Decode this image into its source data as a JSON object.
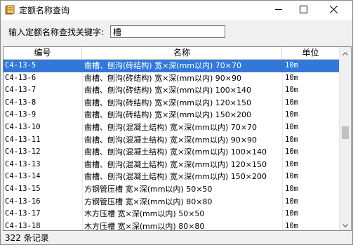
{
  "window": {
    "title": "定额名称查询",
    "app_icon": "book-icon"
  },
  "search": {
    "label": "输入定额名称查找关键字:",
    "value": "槽"
  },
  "table": {
    "columns": [
      "编号",
      "名称",
      "单位"
    ],
    "rows": [
      {
        "code": "C4-13-5",
        "name": "凿槽、刨沟(砖结构) 宽×深(mm以内) 70×70",
        "unit": "10m",
        "selected": true
      },
      {
        "code": "C4-13-6",
        "name": "凿槽、刨沟(砖结构) 宽×深(mm以内) 90×90",
        "unit": "10m"
      },
      {
        "code": "C4-13-7",
        "name": "凿槽、刨沟(砖结构) 宽×深(mm以内) 100×140",
        "unit": "10m"
      },
      {
        "code": "C4-13-8",
        "name": "凿槽、刨沟(砖结构) 宽×深(mm以内) 120×150",
        "unit": "10m"
      },
      {
        "code": "C4-13-9",
        "name": "凿槽、刨沟(砖结构) 宽×深(mm以内) 150×200",
        "unit": "10m"
      },
      {
        "code": "C4-13-10",
        "name": "凿槽、刨沟(混凝土结构) 宽×深(mm以内) 70×70",
        "unit": "10m"
      },
      {
        "code": "C4-13-11",
        "name": "凿槽、刨沟(混凝土结构) 宽×深(mm以内) 90×90",
        "unit": "10m"
      },
      {
        "code": "C4-13-12",
        "name": "凿槽、刨沟(混凝土结构) 宽×深(mm以内) 100×140",
        "unit": "10m"
      },
      {
        "code": "C4-13-13",
        "name": "凿槽、刨沟(混凝土结构) 宽×深(mm以内) 120×150",
        "unit": "10m"
      },
      {
        "code": "C4-13-14",
        "name": "凿槽、刨沟(混凝土结构) 宽×深(mm以内) 150×200",
        "unit": "10m"
      },
      {
        "code": "C4-13-15",
        "name": "方钢管压槽 宽×深(mm以内) 50×50",
        "unit": "10m"
      },
      {
        "code": "C4-13-16",
        "name": "方钢管压槽 宽×深(mm以内) 80×80",
        "unit": "10m"
      },
      {
        "code": "C4-13-17",
        "name": "木方压槽 宽×深(mm以内) 50×50",
        "unit": "10m"
      },
      {
        "code": "C4-13-18",
        "name": "木方压槽 宽×深(mm以内) 80×80",
        "unit": "10m"
      }
    ]
  },
  "status": {
    "text": "322 条记录"
  },
  "colors": {
    "selection": "#3378d6",
    "window_bg": "#f0f0f0"
  }
}
